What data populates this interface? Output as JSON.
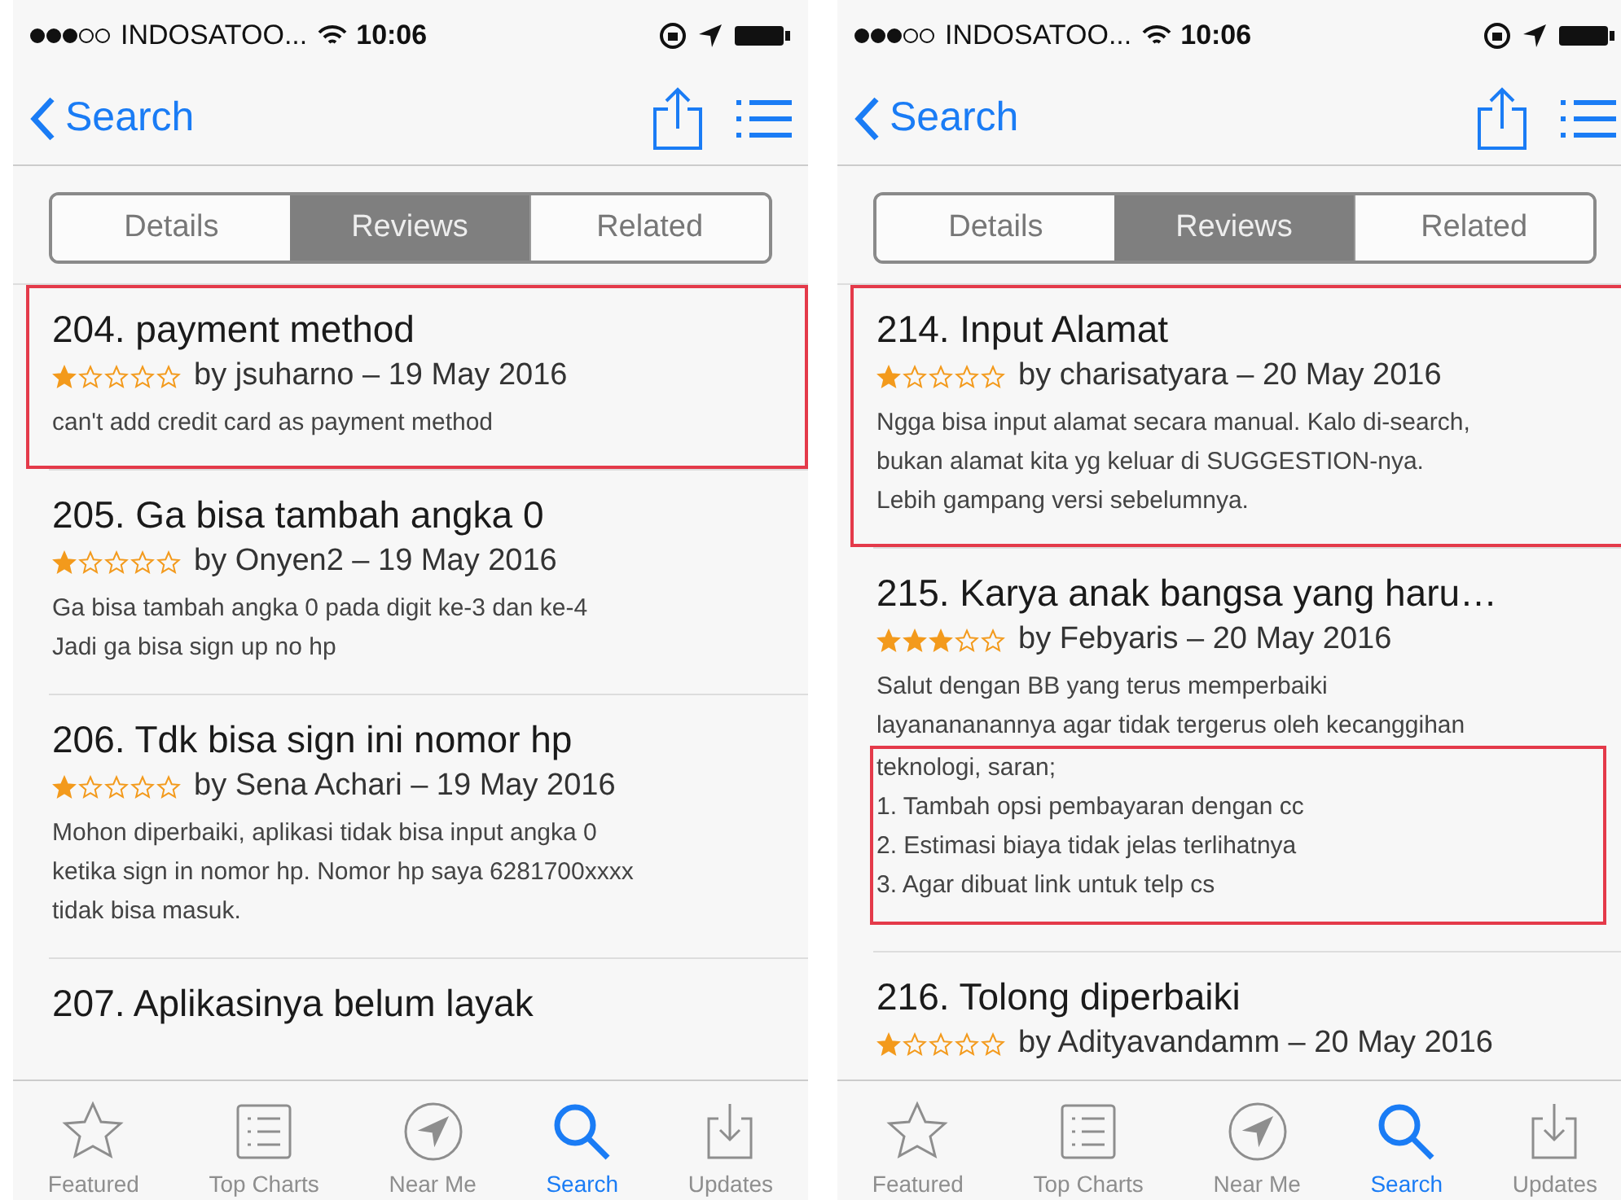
{
  "phones": [
    {
      "status": {
        "carrier": "INDOSATOO...",
        "time": "10:06"
      },
      "nav": {
        "back": "Search"
      },
      "segments": [
        {
          "label": "Details",
          "selected": false
        },
        {
          "label": "Reviews",
          "selected": true
        },
        {
          "label": "Related",
          "selected": false
        }
      ],
      "reviews": [
        {
          "title": "204. payment method",
          "stars": 1,
          "meta": "by jsuharno – 19 May 2016",
          "highlighted": true,
          "lines": [
            {
              "text": "can't add credit card as payment method",
              "highlighted": false
            }
          ]
        },
        {
          "title": "205. Ga bisa tambah angka 0",
          "stars": 1,
          "meta": "by Onyen2 – 19 May 2016",
          "highlighted": false,
          "lines": [
            {
              "text": "Ga bisa tambah angka 0 pada digit ke-3 dan ke-4",
              "highlighted": false
            },
            {
              "text": "Jadi ga bisa sign up no hp",
              "highlighted": false
            }
          ]
        },
        {
          "title": "206. Tdk bisa sign ini nomor hp",
          "stars": 1,
          "meta": "by Sena Achari – 19 May 2016",
          "highlighted": false,
          "lines": [
            {
              "text": "Mohon diperbaiki, aplikasi tidak bisa input angka 0",
              "highlighted": false
            },
            {
              "text": "ketika sign in nomor hp. Nomor hp saya 6281700xxxx",
              "highlighted": false
            },
            {
              "text": "tidak bisa masuk.",
              "highlighted": false
            }
          ]
        },
        {
          "title": "207. Aplikasinya belum layak",
          "highlighted": false
        }
      ],
      "tabbar": [
        {
          "label": "Featured",
          "kind": "star",
          "selected": false
        },
        {
          "label": "Top Charts",
          "kind": "list",
          "selected": false
        },
        {
          "label": "Near Me",
          "kind": "location",
          "selected": false
        },
        {
          "label": "Search",
          "kind": "search",
          "selected": true
        },
        {
          "label": "Updates",
          "kind": "download",
          "selected": false
        }
      ]
    },
    {
      "status": {
        "carrier": "INDOSATOO...",
        "time": "10:06"
      },
      "nav": {
        "back": "Search"
      },
      "segments": [
        {
          "label": "Details",
          "selected": false
        },
        {
          "label": "Reviews",
          "selected": true
        },
        {
          "label": "Related",
          "selected": false
        }
      ],
      "reviews": [
        {
          "title": "214. Input Alamat",
          "stars": 1,
          "meta": "by charisatyara – 20 May 2016",
          "highlighted": true,
          "lines": [
            {
              "text": "Ngga bisa input alamat secara manual. Kalo di-search,",
              "highlighted": false
            },
            {
              "text": "bukan alamat kita yg keluar di SUGGESTION-nya.",
              "highlighted": false
            },
            {
              "text": "Lebih gampang versi sebelumnya.",
              "highlighted": false
            }
          ]
        },
        {
          "title": "215. Karya anak bangsa yang haru…",
          "stars": 3,
          "meta": "by Febyaris – 20 May 2016",
          "highlighted": false,
          "lines": [
            {
              "text": "Salut dengan BB yang terus memperbaiki",
              "highlighted": false
            },
            {
              "text": "layanananannya agar tidak tergerus oleh kecanggihan",
              "highlighted": false
            },
            {
              "text": "teknologi, saran;",
              "highlighted": true
            },
            {
              "text": "1. Tambah opsi pembayaran dengan cc",
              "highlighted": true
            },
            {
              "text": "2. Estimasi biaya tidak jelas terlihatnya",
              "highlighted": true
            },
            {
              "text": "3. Agar dibuat link untuk telp cs",
              "highlighted": true
            }
          ]
        },
        {
          "title": "216. Tolong diperbaiki",
          "stars": 1,
          "meta": "by Adityavandamm – 20 May 2016",
          "highlighted": false
        }
      ],
      "tabbar": [
        {
          "label": "Featured",
          "kind": "star",
          "selected": false
        },
        {
          "label": "Top Charts",
          "kind": "list",
          "selected": false
        },
        {
          "label": "Near Me",
          "kind": "location",
          "selected": false
        },
        {
          "label": "Search",
          "kind": "search",
          "selected": true
        },
        {
          "label": "Updates",
          "kind": "download",
          "selected": false
        }
      ]
    }
  ]
}
